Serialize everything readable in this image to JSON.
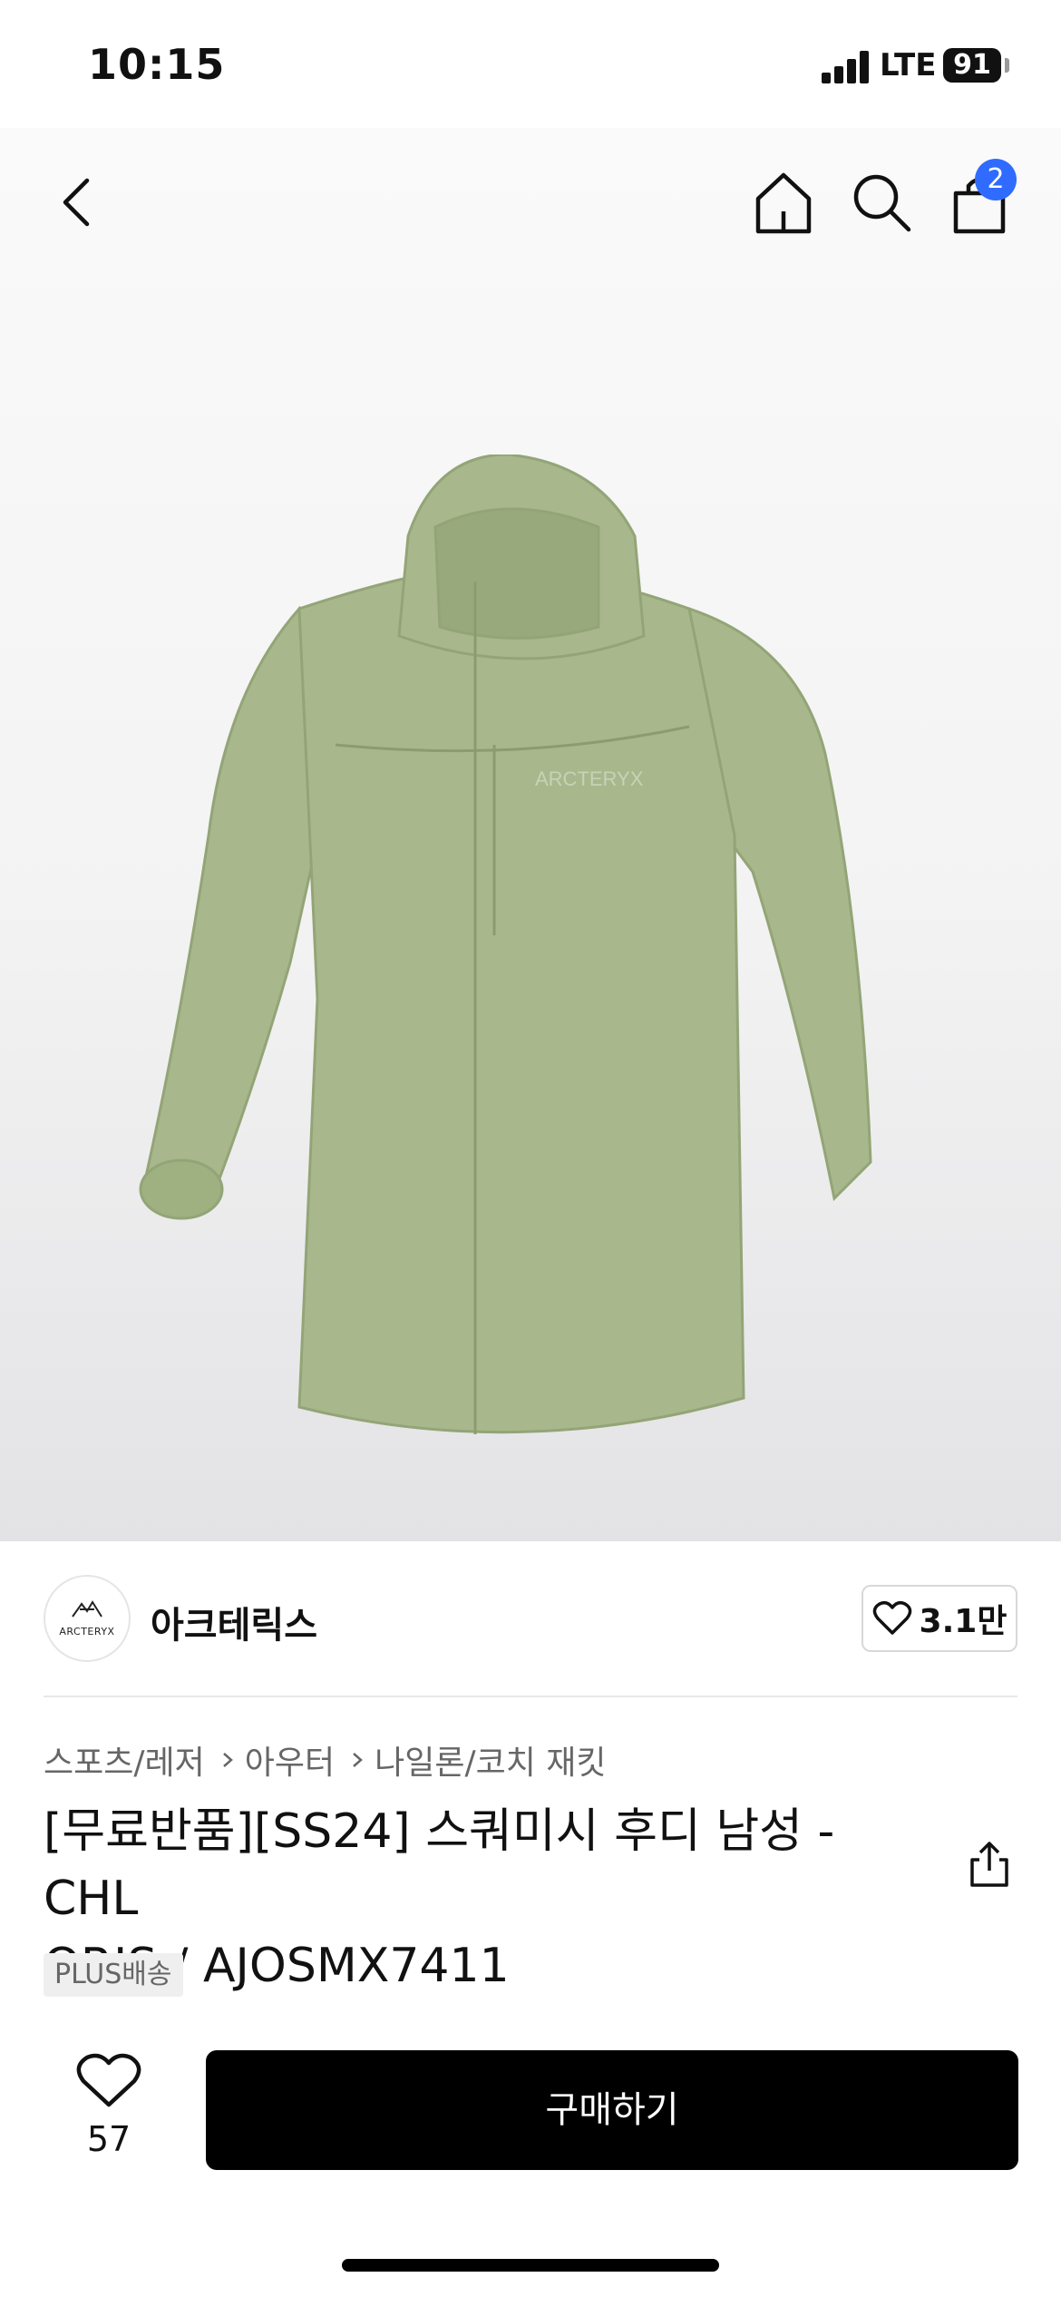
{
  "status_bar": {
    "time": "10:15",
    "network": "LTE",
    "battery": "91"
  },
  "header": {
    "cart_count": "2"
  },
  "brand": {
    "logo_text": "ARCTERYX",
    "name": "아크테릭스",
    "likes": "3.1만"
  },
  "breadcrumb": [
    "스포츠/레저",
    "아우터",
    "나일론/코치 재킷"
  ],
  "product": {
    "title_line1": "[무료반품][SS24] 스쿼미시 후디 남성 - CHL",
    "title_line2": "ORIS / AJOSMX7411",
    "shipping_badge": "PLUS배송",
    "image_color": "#a8b88c"
  },
  "bottom_bar": {
    "wish_count": "57",
    "buy_label": "구매하기"
  },
  "colors": {
    "accent_badge": "#2f6bff",
    "primary_button": "#000000"
  }
}
